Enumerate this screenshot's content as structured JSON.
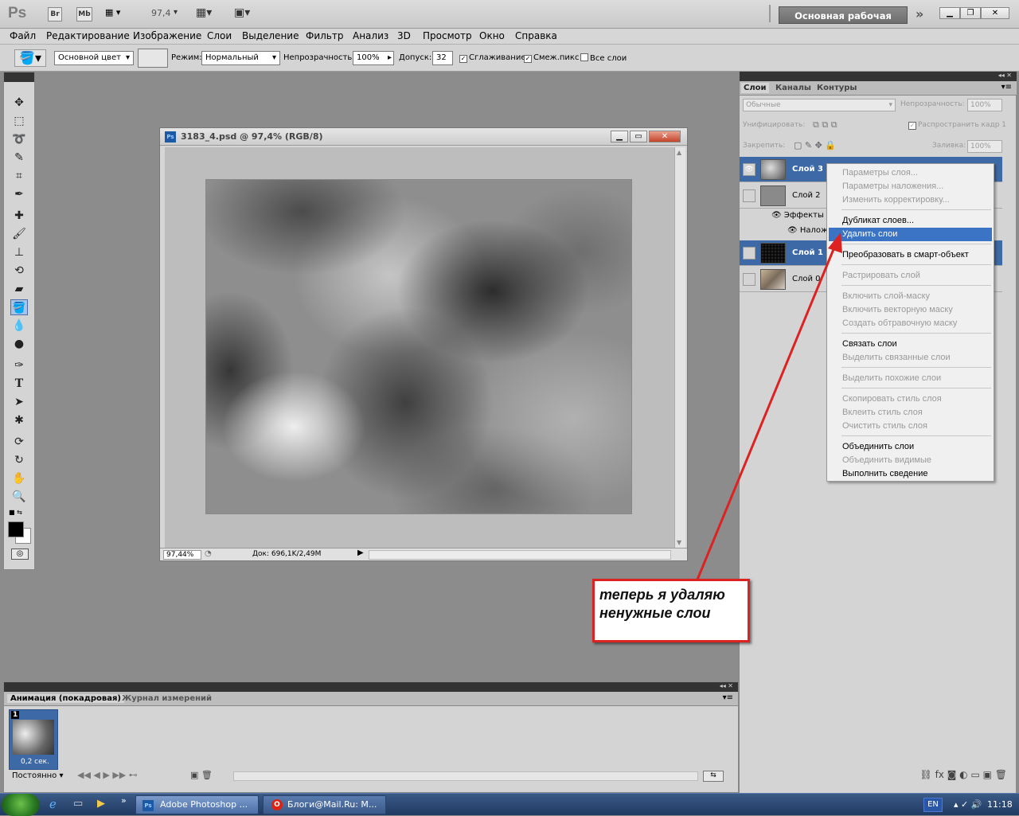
{
  "appbar": {
    "logo": "Ps",
    "br": "Br",
    "mb": "Mb",
    "zoom": "97,4",
    "workspace": "Основная рабочая среда",
    "expand": "»"
  },
  "menu": [
    "Файл",
    "Редактирование",
    "Изображение",
    "Слои",
    "Выделение",
    "Фильтр",
    "Анализ",
    "3D",
    "Просмотр",
    "Окно",
    "Справка"
  ],
  "options": {
    "fill_source": "Основной цвет",
    "mode_label": "Режим:",
    "mode_value": "Нормальный",
    "opacity_label": "Непрозрачность:",
    "opacity_value": "100%",
    "tolerance_label": "Допуск:",
    "tolerance_value": "32",
    "antialias": "Сглаживание",
    "contiguous": "Смеж.пикс",
    "all_layers": "Все слои"
  },
  "document": {
    "title": "3183_4.psd @ 97,4% (RGB/8)",
    "zoom_status": "97,44%",
    "doc_info": "Док: 696,1K/2,49M"
  },
  "layers_panel": {
    "tabs": [
      "Слои",
      "Каналы",
      "Контуры"
    ],
    "blend_mode": "Обычные",
    "opacity_label": "Непрозрачность:",
    "opacity_value": "100%",
    "unify_label": "Унифицировать:",
    "propagate": "Распространить кадр 1",
    "lock_label": "Закрепить:",
    "fill_label": "Заливка:",
    "fill_value": "100%",
    "effects_label": "Эффекты",
    "overlay_label": "Налож",
    "layers": [
      {
        "name": "Слой 3",
        "selected": true,
        "visible": true
      },
      {
        "name": "Слой 2",
        "selected": false,
        "visible": false
      },
      {
        "name": "Слой 1",
        "selected": true,
        "visible": false
      },
      {
        "name": "Слой 0",
        "selected": false,
        "visible": false
      }
    ]
  },
  "context_menu": {
    "items": [
      {
        "label": "Параметры слоя...",
        "enabled": false
      },
      {
        "label": "Параметры наложения...",
        "enabled": false
      },
      {
        "label": "Изменить корректировку...",
        "enabled": false
      },
      {
        "label": "Дубликат слоев...",
        "enabled": true
      },
      {
        "label": "Удалить слои",
        "enabled": true,
        "highlighted": true
      },
      {
        "label": "Преобразовать в смарт-объект",
        "enabled": true
      },
      {
        "label": "Растрировать слой",
        "enabled": false
      },
      {
        "label": "Включить слой-маску",
        "enabled": false
      },
      {
        "label": "Включить векторную маску",
        "enabled": false
      },
      {
        "label": "Создать обтравочную маску",
        "enabled": false
      },
      {
        "label": "Связать слои",
        "enabled": true
      },
      {
        "label": "Выделить связанные слои",
        "enabled": false
      },
      {
        "label": "Выделить похожие слои",
        "enabled": false
      },
      {
        "label": "Скопировать стиль слоя",
        "enabled": false
      },
      {
        "label": "Вклеить стиль слоя",
        "enabled": false
      },
      {
        "label": "Очистить стиль слоя",
        "enabled": false
      },
      {
        "label": "Объединить слои",
        "enabled": true
      },
      {
        "label": "Объединить видимые",
        "enabled": false
      },
      {
        "label": "Выполнить сведение",
        "enabled": true
      }
    ]
  },
  "animation_panel": {
    "tabs": [
      "Анимация (покадровая)",
      "Журнал измерений"
    ],
    "frame_number": "1",
    "frame_delay": "0,2 сек.",
    "loop": "Постоянно"
  },
  "annotation": {
    "line1": "теперь я удаляю",
    "line2": "ненужные слои"
  },
  "taskbar": {
    "tasks": [
      "Adobe Photoshop ...",
      "Блоги@Mail.Ru: М..."
    ],
    "lang": "EN",
    "time": "11:18"
  },
  "colors": {
    "selection": "#3d6aa6",
    "menu_highlight": "#3b74c4",
    "annotation_border": "#dd2222"
  }
}
